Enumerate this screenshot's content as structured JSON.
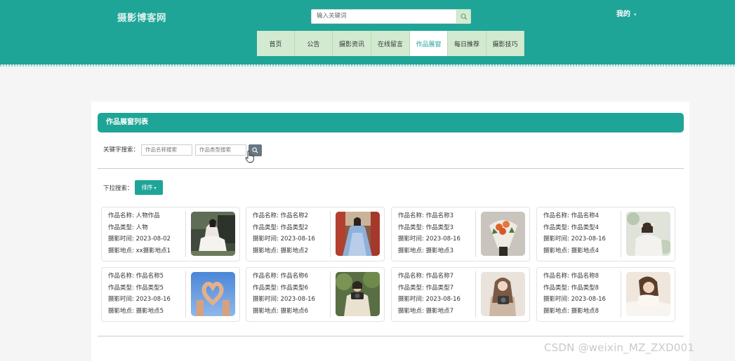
{
  "header": {
    "logo": "摄影博客网",
    "search_placeholder": "输入关键词",
    "user_menu": "我的"
  },
  "nav": [
    {
      "label": "首页",
      "active": false
    },
    {
      "label": "公告",
      "active": false
    },
    {
      "label": "摄影资讯",
      "active": false
    },
    {
      "label": "在线留言",
      "active": false
    },
    {
      "label": "作品展窗",
      "active": true
    },
    {
      "label": "每日推荐",
      "active": false
    },
    {
      "label": "摄影技巧",
      "active": false
    }
  ],
  "panel": {
    "title": "作品展窗列表",
    "keyword_label": "关键字搜索：",
    "name_placeholder": "作品名称搜索",
    "type_placeholder": "作品类型搜索",
    "dropdown_label": "下拉搜索：",
    "sort_label": "排序"
  },
  "cards": [
    {
      "name": "作品名称: 人物作品",
      "type": "作品类型: 人物",
      "time": "摄影时间: 2023-08-02",
      "place": "摄影地点: xx摄影地点1"
    },
    {
      "name": "作品名称: 作品名称2",
      "type": "作品类型: 作品类型2",
      "time": "摄影时间: 2023-08-16",
      "place": "摄影地点: 摄影地点2"
    },
    {
      "name": "作品名称: 作品名称3",
      "type": "作品类型: 作品类型3",
      "time": "摄影时间: 2023-08-16",
      "place": "摄影地点: 摄影地点3"
    },
    {
      "name": "作品名称: 作品名称4",
      "type": "作品类型: 作品类型4",
      "time": "摄影时间: 2023-08-16",
      "place": "摄影地点: 摄影地点4"
    },
    {
      "name": "作品名称: 作品名称5",
      "type": "作品类型: 作品类型5",
      "time": "摄影时间: 2023-08-16",
      "place": "摄影地点: 摄影地点5"
    },
    {
      "name": "作品名称: 作品名称6",
      "type": "作品类型: 作品类型6",
      "time": "摄影时间: 2023-08-16",
      "place": "摄影地点: 摄影地点6"
    },
    {
      "name": "作品名称: 作品名称7",
      "type": "作品类型: 作品类型7",
      "time": "摄影时间: 2023-08-16",
      "place": "摄影地点: 摄影地点7"
    },
    {
      "name": "作品名称: 作品名称8",
      "type": "作品类型: 作品类型8",
      "time": "摄影时间: 2023-08-16",
      "place": "摄影地点: 摄影地点8"
    }
  ],
  "watermark": "CSDN @weixin_MZ_ZXD001",
  "colors": {
    "primary": "#1fa597",
    "nav_bg": "#d2ebd0",
    "search_btn": "#667783"
  }
}
